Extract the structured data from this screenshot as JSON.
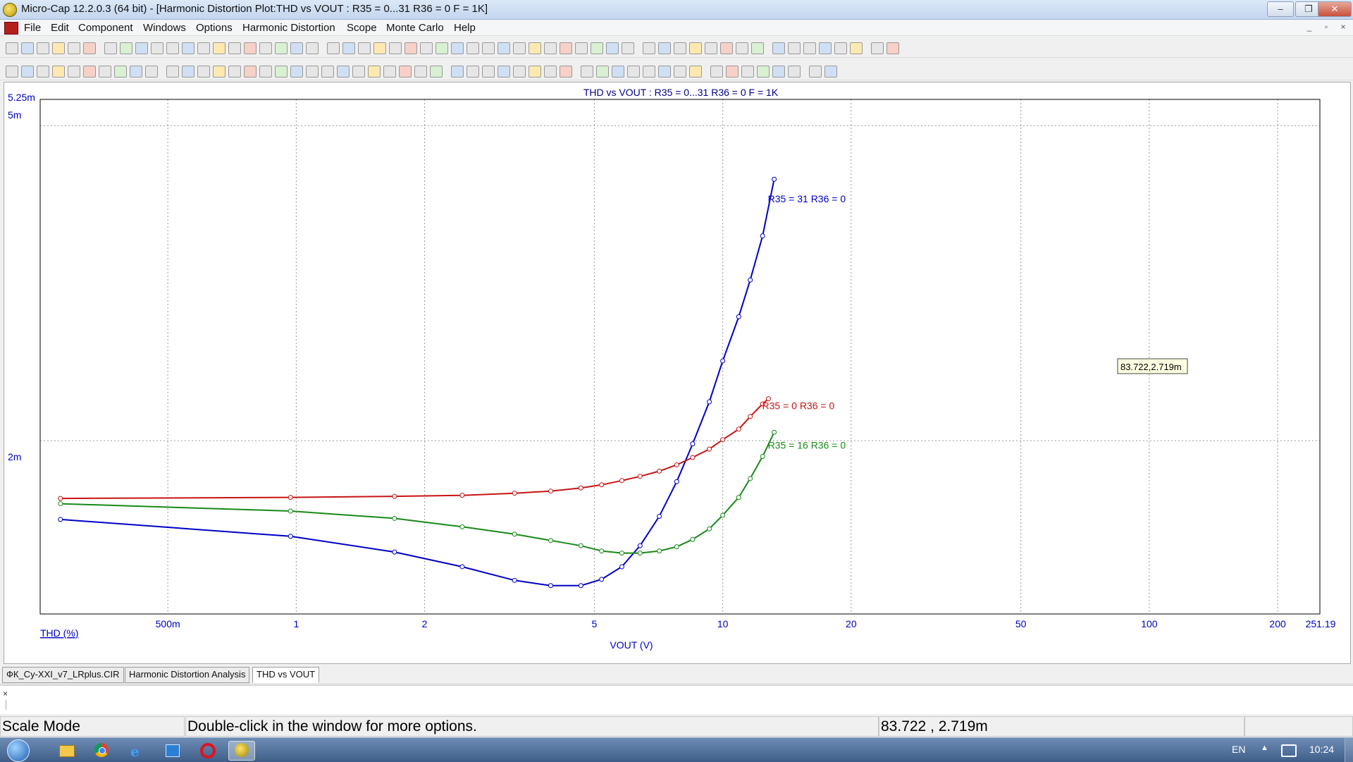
{
  "window": {
    "title": "Micro-Cap 12.2.0.3 (64 bit) - [Harmonic Distortion Plot:THD vs VOUT : R35 = 0...31 R36 = 0 F = 1K]",
    "controls": [
      "–",
      "❐",
      "✕"
    ],
    "mdi_controls": [
      "_",
      "▫",
      "×"
    ]
  },
  "menu": [
    "File",
    "Edit",
    "Component",
    "Windows",
    "Options",
    "Harmonic Distortion",
    "Scope",
    "Monte Carlo",
    "Help"
  ],
  "plot": {
    "title": "THD vs VOUT : R35 = 0...31 R36 = 0 F = 1K",
    "y_top_label": "5.25m",
    "y_tick_labels": [
      "5m",
      "2m"
    ],
    "x_tick_labels": [
      "500m",
      "1",
      "2",
      "5",
      "10",
      "20",
      "50",
      "100",
      "200",
      "251.19"
    ],
    "y_axis_label": "THD (%)",
    "x_axis_label": "VOUT (V)",
    "cursor_readout": "83.722,2.719m"
  },
  "chart_data": {
    "type": "line",
    "title": "THD vs VOUT : R35 = 0...31 R36 = 0 F = 1K",
    "xlabel": "VOUT (V)",
    "ylabel": "THD (%)",
    "xscale": "log",
    "xlim": [
      0.251,
      251.19
    ],
    "ylim": [
      0.00035,
      0.00525
    ],
    "grid": true,
    "series": [
      {
        "name": "R35 = 31 R36 = 0",
        "color": "#0000c8",
        "x": [
          0.28,
          0.97,
          1.7,
          2.45,
          3.25,
          3.95,
          4.65,
          5.2,
          5.8,
          6.4,
          7.1,
          7.8,
          8.5,
          9.3,
          10.0,
          10.9,
          11.6,
          12.4,
          13.2
        ],
        "y": [
          0.00125,
          0.00109,
          0.00094,
          0.0008,
          0.00067,
          0.00062,
          0.00062,
          0.00068,
          0.0008,
          0.001,
          0.00128,
          0.00161,
          0.00197,
          0.00237,
          0.00276,
          0.00318,
          0.00353,
          0.00395,
          0.00449
        ]
      },
      {
        "name": "R35 = 0 R36 = 0",
        "color": "#c81414",
        "x": [
          0.28,
          0.97,
          1.7,
          2.45,
          3.25,
          3.95,
          4.65,
          5.2,
          5.8,
          6.4,
          7.1,
          7.8,
          8.5,
          9.3,
          10.0,
          10.9,
          11.6,
          12.4,
          12.8
        ],
        "y": [
          0.00145,
          0.00146,
          0.00147,
          0.00148,
          0.0015,
          0.00152,
          0.00155,
          0.00158,
          0.00162,
          0.00166,
          0.00171,
          0.00177,
          0.00184,
          0.00192,
          0.00201,
          0.00211,
          0.00223,
          0.00235,
          0.0024
        ]
      },
      {
        "name": "R35 = 16 R36 = 0",
        "color": "#188a18",
        "x": [
          0.28,
          0.97,
          1.7,
          2.45,
          3.25,
          3.95,
          4.65,
          5.2,
          5.8,
          6.4,
          7.1,
          7.8,
          8.5,
          9.3,
          10.0,
          10.9,
          11.6,
          12.4,
          13.2
        ],
        "y": [
          0.0014,
          0.00133,
          0.00126,
          0.00118,
          0.00111,
          0.00105,
          0.001,
          0.00095,
          0.00093,
          0.00093,
          0.00095,
          0.00099,
          0.00106,
          0.00116,
          0.00129,
          0.00146,
          0.00164,
          0.00185,
          0.00208
        ]
      }
    ]
  },
  "tabs": [
    "ФК_Cy-XXI_v7_LRplus.CIR",
    "Harmonic Distortion Analysis",
    "THD vs VOUT"
  ],
  "active_tab": "THD vs VOUT",
  "command_pane": {
    "close_label": "×"
  },
  "status": {
    "mode": "Scale Mode",
    "hint": "Double-click in the window for more options.",
    "coords": "83.722 , 2.719m"
  },
  "taskbar": {
    "language": "EN",
    "time": "10:24",
    "icons": [
      "start-orb-icon",
      "file-explorer-icon",
      "chrome-icon",
      "internet-explorer-icon",
      "app-window-icon",
      "opera-icon",
      "microcap-icon"
    ]
  }
}
